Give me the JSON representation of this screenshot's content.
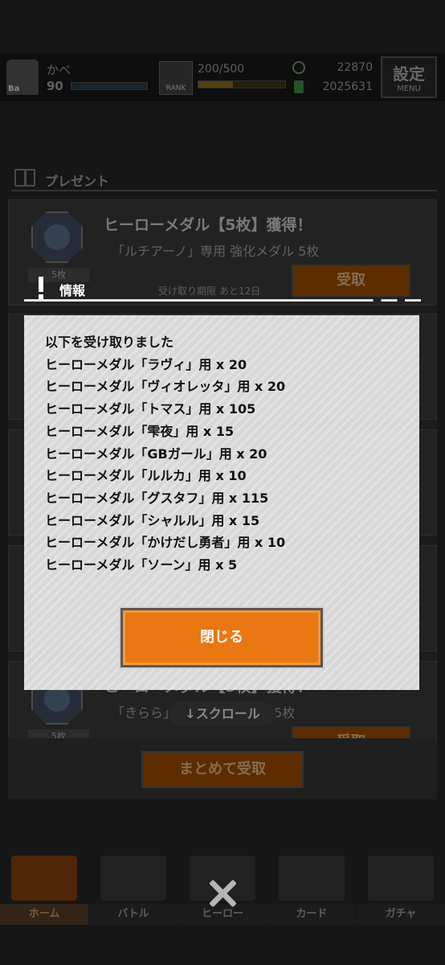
{
  "header": {
    "player_name": "かべ",
    "level": "90",
    "avatar_level": "Ba",
    "rank_label": "RANK",
    "stamina": "200/500",
    "coins": "22870",
    "gems": "2025631",
    "settings_label": "設定",
    "settings_sub": "MENU",
    "exp_fraction": 0.0,
    "stamina_fraction": 0.4
  },
  "present": {
    "section_title": "プレゼント",
    "cards": [
      {
        "title": "ヒーローメダル【5枚】獲得！",
        "subtitle": "「ルチアーノ」専用 強化メダル 5枚",
        "count": "5枚",
        "deadline": "受け取り期限 あと12日",
        "button": "受取"
      },
      {
        "title": "ヒーローメダル【5枚】獲得！",
        "subtitle": "「きらら」専用 強化メダル 5枚",
        "count": "5枚",
        "deadline": "",
        "button": "受取"
      }
    ],
    "scroll_hint": "↓スクロール",
    "receive_all": "まとめて受取"
  },
  "nav": {
    "items": [
      {
        "label": "ホーム",
        "active": true
      },
      {
        "label": "バトル"
      },
      {
        "label": "ヒーロー"
      },
      {
        "label": "カード"
      },
      {
        "label": "ガチャ"
      }
    ]
  },
  "modal": {
    "title": "情報",
    "lines": [
      "以下を受け取りました",
      "ヒーローメダル「ラヴィ」用 x 20",
      "ヒーローメダル「ヴィオレッタ」用 x 20",
      "ヒーローメダル「トマス」用 x 105",
      "ヒーローメダル「雫夜」用 x 15",
      "ヒーローメダル「GBガール」用 x 20",
      "ヒーローメダル「ルルカ」用 x 10",
      "ヒーローメダル「グスタフ」用 x 115",
      "ヒーローメダル「シャルル」用 x 15",
      "ヒーローメダル「かけだし勇者」用 x 10",
      "ヒーローメダル「ソーン」用 x 5"
    ],
    "close_button": "閉じる"
  },
  "colors": {
    "accent": "#f07a12",
    "modal_bg": "#dedede"
  }
}
